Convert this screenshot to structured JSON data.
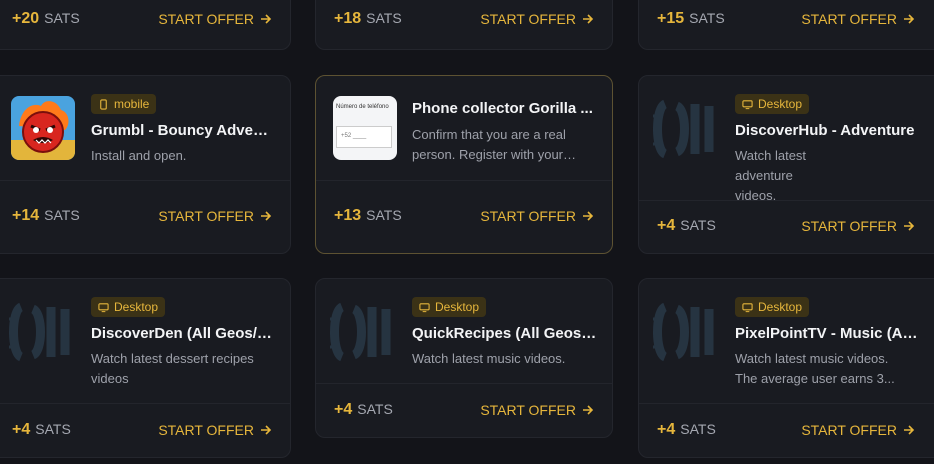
{
  "colors": {
    "accent": "#e6b63c",
    "background": "#131419",
    "card": "#191b21"
  },
  "offers": [
    {
      "reward": "+20",
      "unit": "SATS",
      "cta": "START OFFER"
    },
    {
      "reward": "+18",
      "unit": "SATS",
      "cta": "START OFFER"
    },
    {
      "reward": "+15",
      "unit": "SATS",
      "cta": "START OFFER"
    },
    {
      "badge": "mobile",
      "badge_icon": "phone-icon",
      "title": "Grumbl - Bouncy Adventure",
      "desc": "Install and open.",
      "reward": "+14",
      "unit": "SATS",
      "cta": "START OFFER",
      "image": "bouncy-ball-game-icon"
    },
    {
      "title": "Phone collector Gorilla ...",
      "desc": "Confirm that you are a real person. Register with your phone number.",
      "reward": "+13",
      "unit": "SATS",
      "cta": "START OFFER",
      "image": "phone-number-form-thumbnail",
      "thumb_label": "Número de teléfono",
      "thumb_placeholder": "+52 ____"
    },
    {
      "badge": "Desktop",
      "badge_icon": "monitor-icon",
      "title": "DiscoverHub - Adventure",
      "desc": "Watch latest adventure videos.",
      "reward": "+4",
      "unit": "SATS",
      "cta": "START OFFER",
      "image": "placeholder-logo"
    },
    {
      "badge": "Desktop",
      "badge_icon": "monitor-icon",
      "title": "DiscoverDen (All Geos/Desktop)",
      "desc": "Watch latest dessert recipes videos",
      "reward": "+4",
      "unit": "SATS",
      "cta": "START OFFER",
      "image": "placeholder-logo"
    },
    {
      "badge": "Desktop",
      "badge_icon": "monitor-icon",
      "title": "QuickRecipes (All Geos/Desktop)",
      "desc": "Watch latest music videos.",
      "reward": "+4",
      "unit": "SATS",
      "cta": "START OFFER",
      "image": "placeholder-logo"
    },
    {
      "badge": "Desktop",
      "badge_icon": "monitor-icon",
      "title": "PixelPointTV - Music (All Geos)",
      "desc": "Watch latest music videos. The average user earns 3...",
      "reward": "+4",
      "unit": "SATS",
      "cta": "START OFFER",
      "image": "placeholder-logo"
    }
  ]
}
